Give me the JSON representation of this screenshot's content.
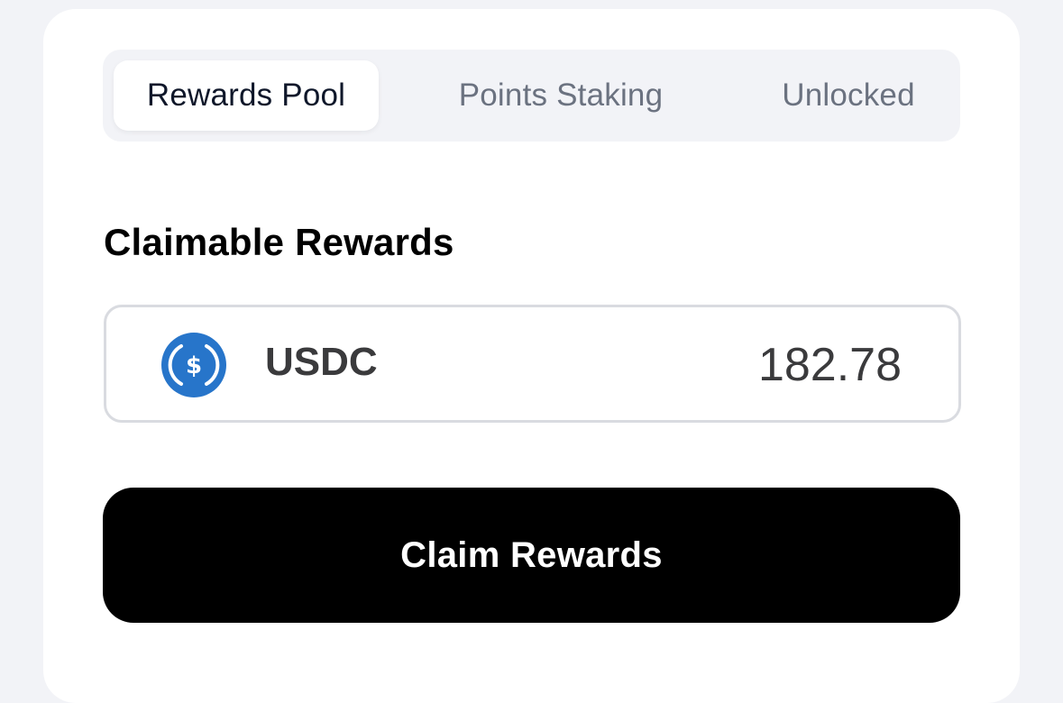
{
  "tabs": [
    {
      "label": "Rewards Pool",
      "active": true
    },
    {
      "label": "Points Staking",
      "active": false
    },
    {
      "label": "Unlocked",
      "active": false
    }
  ],
  "section": {
    "title": "Claimable Rewards"
  },
  "reward": {
    "token_icon": "usdc-coin-icon",
    "token": "USDC",
    "amount": "182.78"
  },
  "actions": {
    "claim_label": "Claim Rewards"
  },
  "colors": {
    "page_background": "#f2f3f7",
    "card_background": "#ffffff",
    "usdc_blue": "#2775ca",
    "button_background": "#000000",
    "button_text": "#ffffff",
    "inactive_tab_text": "#6b7280"
  }
}
